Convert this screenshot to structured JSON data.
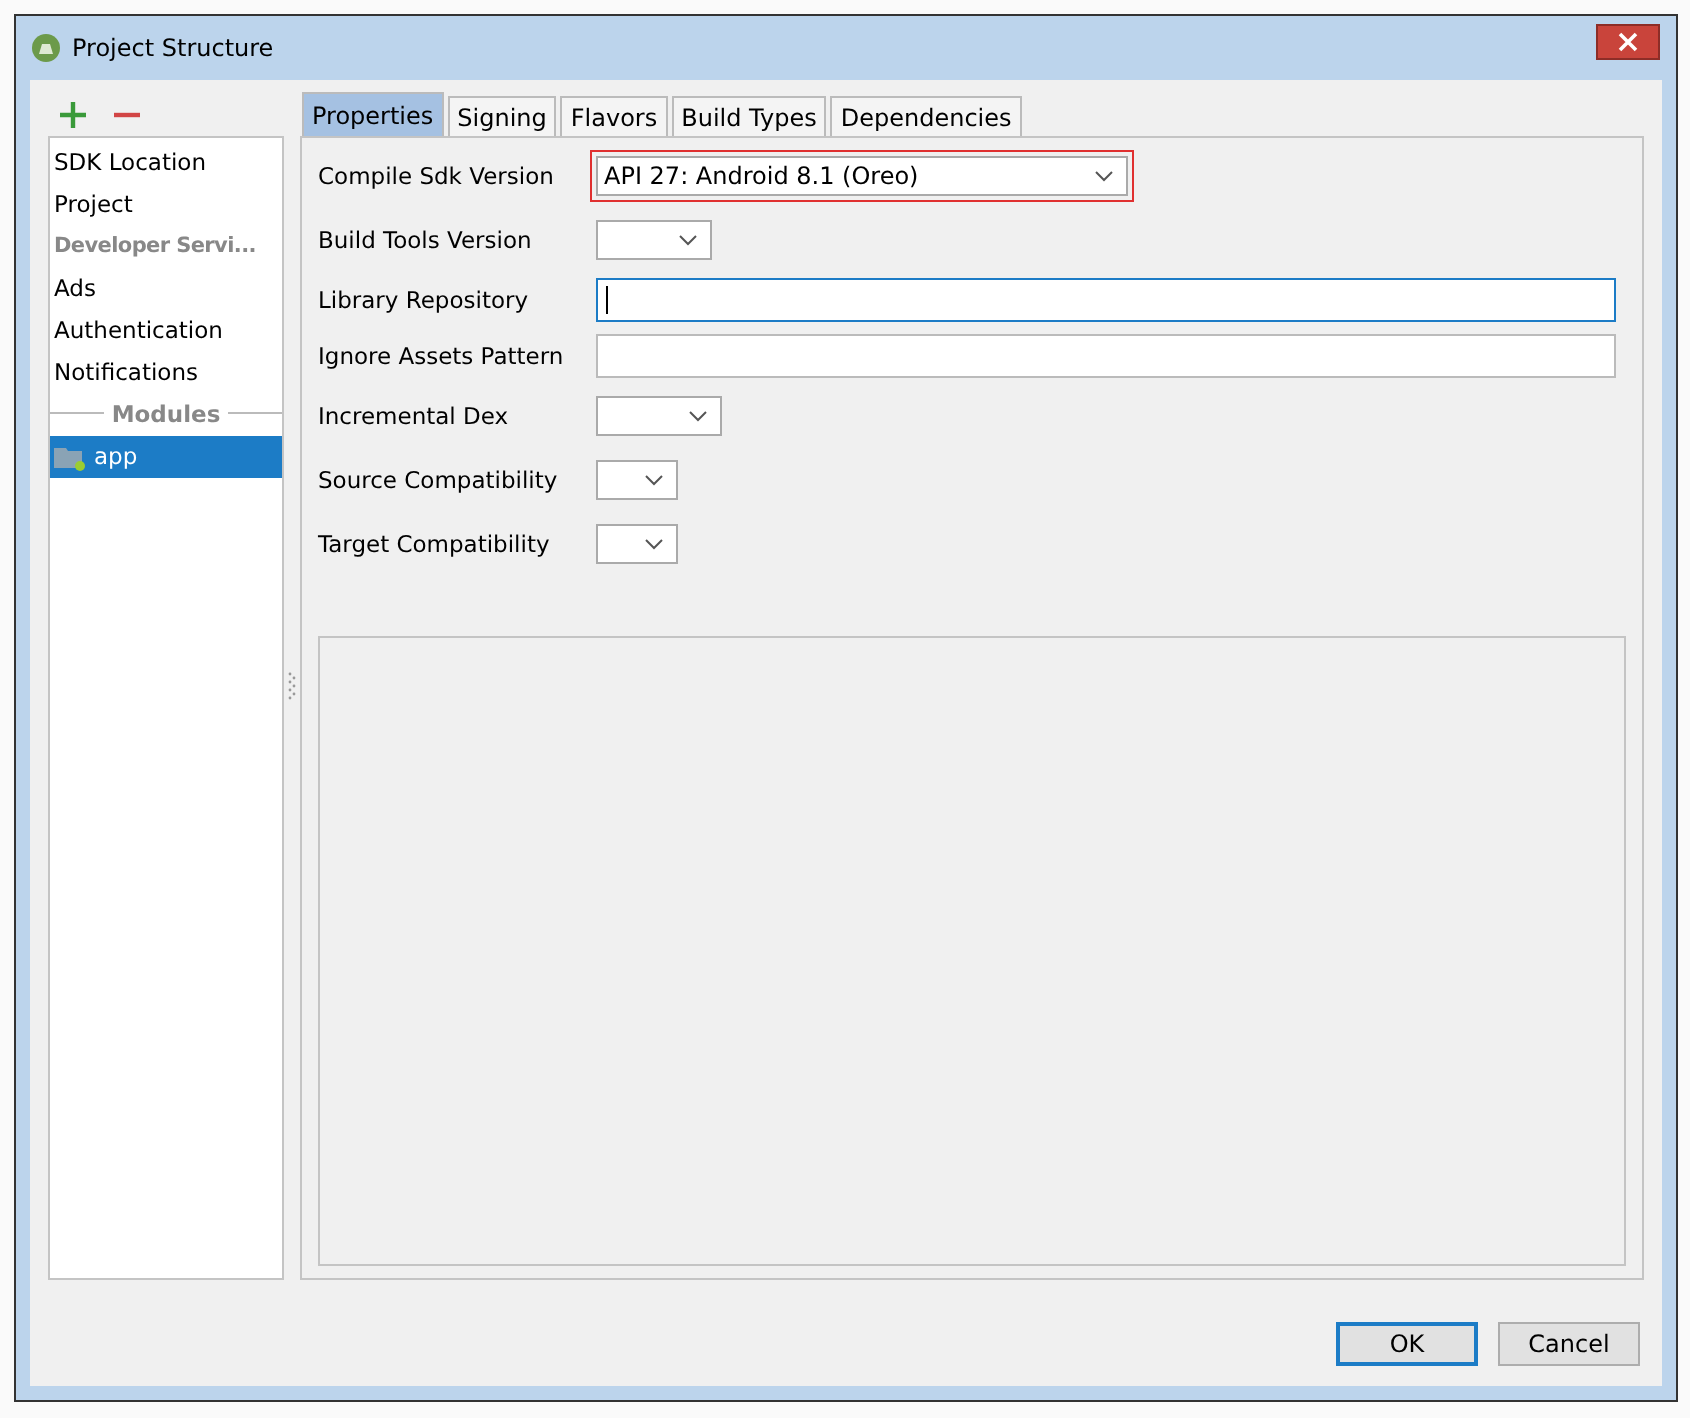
{
  "window": {
    "title": "Project Structure"
  },
  "sidebar": {
    "items": [
      {
        "kind": "item",
        "label": "SDK Location",
        "selected": false
      },
      {
        "kind": "item",
        "label": "Project",
        "selected": false
      },
      {
        "kind": "header",
        "label": "Developer Servi..."
      },
      {
        "kind": "item",
        "label": "Ads",
        "selected": false
      },
      {
        "kind": "item",
        "label": "Authentication",
        "selected": false
      },
      {
        "kind": "item",
        "label": "Notifications",
        "selected": false
      },
      {
        "kind": "separator",
        "label": "Modules"
      },
      {
        "kind": "module",
        "label": "app",
        "selected": true
      }
    ]
  },
  "tabs": [
    {
      "label": "Properties",
      "selected": true
    },
    {
      "label": "Signing",
      "selected": false
    },
    {
      "label": "Flavors",
      "selected": false
    },
    {
      "label": "Build Types",
      "selected": false
    },
    {
      "label": "Dependencies",
      "selected": false
    }
  ],
  "fields": [
    {
      "kind": "dropdown",
      "label": "Compile Sdk Version",
      "value": "API 27: Android 8.1 (Oreo)",
      "highlighted": true
    },
    {
      "kind": "dropdown",
      "label": "Build Tools Version",
      "highlighted": false
    },
    {
      "kind": "text",
      "label": "Library Repository",
      "focused": true
    },
    {
      "kind": "text",
      "label": "Ignore Assets Pattern",
      "focused": false
    },
    {
      "kind": "dropdown",
      "label": "Incremental Dex",
      "highlighted": false
    },
    {
      "kind": "dropdown",
      "label": "Source Compatibility",
      "highlighted": false
    },
    {
      "kind": "dropdown",
      "label": "Target Compatibility",
      "highlighted": false
    }
  ],
  "buttons": [
    {
      "label": "OK",
      "default": true
    },
    {
      "label": "Cancel",
      "default": false
    }
  ]
}
